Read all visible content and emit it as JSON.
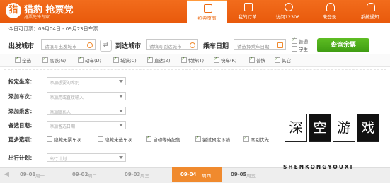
{
  "header": {
    "logo_char": "猎",
    "brand": "猎豹 抢票党",
    "brand_sub": "抢票先锋专家",
    "nav": [
      {
        "label": "抢票页面",
        "icon": "ticket-icon"
      },
      {
        "label": "我的订单",
        "icon": "order-icon"
      },
      {
        "label": "访问12306",
        "icon": "globe-icon"
      },
      {
        "label": "未登录",
        "icon": "user-icon"
      },
      {
        "label": "系统通知",
        "icon": "bell-icon"
      }
    ]
  },
  "search": {
    "date_range": "今日可订票：09月04日 - 09月23日车票",
    "from_label": "出发城市",
    "from_placeholder": "请填写出发城市",
    "to_label": "到达城市",
    "to_placeholder": "请填写到达城市",
    "date_label": "乘车日期",
    "date_placeholder": "请选择乘车日期",
    "ticket_types": [
      "普通",
      "学生"
    ],
    "query_button": "查询余票",
    "swap_icon": "⇄"
  },
  "train_types": [
    "全选",
    "高铁(G)",
    "动车(D)",
    "城铁(C)",
    "直达(Z)",
    "特快(T)",
    "快车(K)",
    "普快",
    "其它"
  ],
  "form": {
    "seat_label": "指定坐席：",
    "seat_placeholder": "添加想要的席别",
    "train_label": "添加车次：",
    "train_placeholder": "添加用或直接输入",
    "passenger_label": "添加乘客：",
    "passenger_placeholder": "添加联系人",
    "backup_date_label": "备选日期：",
    "backup_date_placeholder": "添加备选日期",
    "more_label": "更多选项：",
    "options": [
      "隐藏无票车次",
      "隐藏未选车次",
      "自动等待起售",
      "尝试预定下铺",
      "席别优先"
    ],
    "plan_label": "出行计划：",
    "plan_placeholder": "出行计划"
  },
  "date_tabs": [
    {
      "date": "09-01",
      "weekday": "周一"
    },
    {
      "date": "09-02",
      "weekday": "周二"
    },
    {
      "date": "09-03",
      "weekday": "周三"
    },
    {
      "date": "09-04",
      "weekday": "周四"
    },
    {
      "date": "09-05",
      "weekday": "周五"
    }
  ],
  "watermark": {
    "chars": [
      "深",
      "空",
      "游",
      "戏"
    ],
    "sub": "SHENKONGYOUXI"
  }
}
